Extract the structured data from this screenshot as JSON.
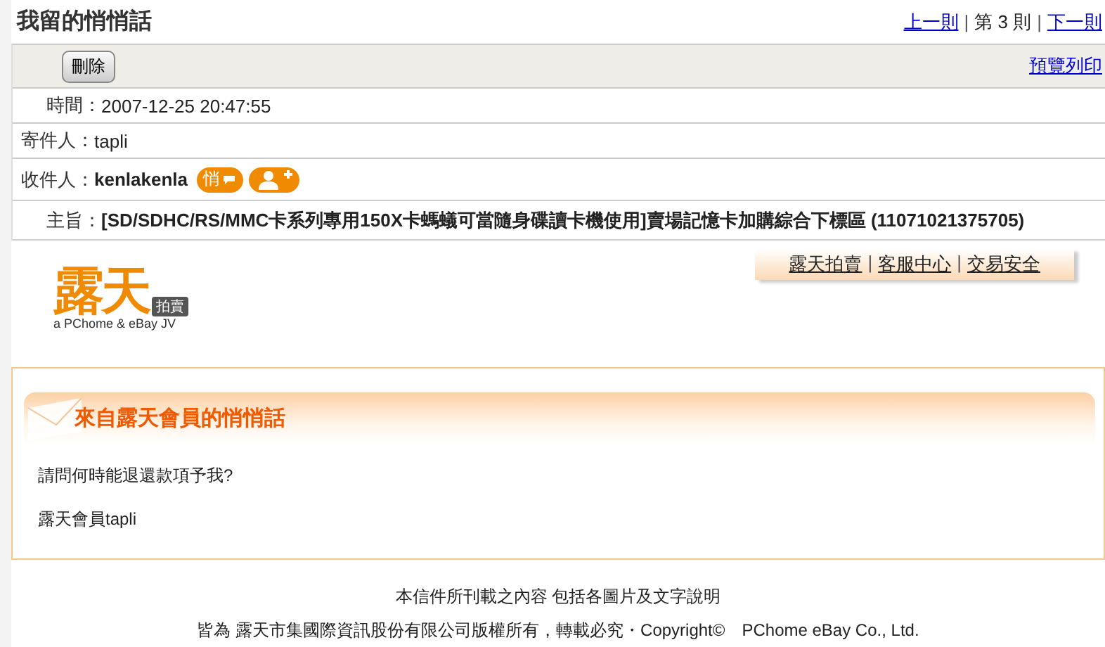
{
  "title": "我留的悄悄話",
  "pager": {
    "prev": "上一則",
    "current": "第 3 則",
    "next": "下一則",
    "separator": "|"
  },
  "toolbar": {
    "delete": "刪除",
    "print": "預覽列印"
  },
  "fields": [
    {
      "kind": "plain",
      "label": "時間：",
      "value": "2007-12-25 20:47:55"
    },
    {
      "kind": "plain",
      "label": "寄件人：",
      "value": "tapli"
    },
    {
      "kind": "recipient",
      "label": "收件人：",
      "value": "kenlakenla",
      "badge": "悄"
    },
    {
      "kind": "bold",
      "label": "主旨：",
      "value": "[SD/SDHC/RS/MMC卡系列專用150X卡螞蟻可當隨身碟讀卡機使用]賣場記憶卡加購綜合下標區 (11071021375705)"
    }
  ],
  "logo": {
    "main": "露天",
    "badge": "拍賣",
    "tagline": "a PChome & eBay JV"
  },
  "site_links": [
    "露天拍賣",
    "客服中心",
    "交易安全"
  ],
  "site_links_separator": "|",
  "message": {
    "heading": "來自露天會員的悄悄話",
    "lines": [
      "請問何時能退還款項予我?",
      "露天會員tapli"
    ]
  },
  "footer": [
    "本信件所刊載之內容 包括各圖片及文字說明",
    "皆為 露天市集國際資訊股份有限公司版權所有，轉載必究・Copyright©　PChome eBay Co., Ltd."
  ]
}
